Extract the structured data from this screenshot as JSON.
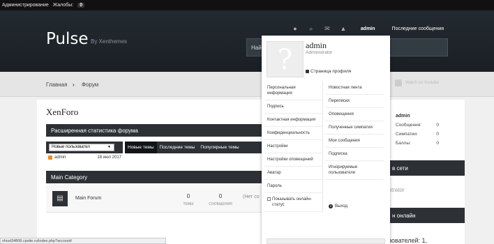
{
  "adminbar": {
    "admin_link": "Администрирование",
    "reports_label": "Жалобы:",
    "reports_count": "0"
  },
  "header": {
    "logo": "Pulse",
    "byline": "By Xenthemes",
    "search_label": "Найти"
  },
  "topnav": {
    "user": "admin",
    "recent": "Последние сообщения"
  },
  "breadcrumb": {
    "home": "Главная",
    "separator": "›",
    "forum": "Форум"
  },
  "youtube": {
    "label": "Watch on Youtube"
  },
  "page": {
    "title": "XenForo"
  },
  "stats": {
    "title": "Расширенная статистика форума",
    "select_value": "Новые пользовател",
    "user": "admin",
    "date": "18 июл 2017",
    "tabs": [
      "Новые темы",
      "Последние темы",
      "Популярные темы"
    ]
  },
  "category": {
    "title": "Main Category",
    "forum": "Main Forum",
    "threads_count": "0",
    "threads_label": "ТЕМЫ",
    "posts_count": "0",
    "posts_label": "СООБЩЕНИЯ",
    "last_post": "(Нет со"
  },
  "sidebar": {
    "user": "admin",
    "rows": [
      {
        "label": "Сообщения:",
        "value": "0"
      },
      {
        "label": "Симпатии:",
        "value": "0"
      },
      {
        "label": "Баллы:",
        "value": "0"
      }
    ],
    "online_title": "в сети",
    "online_user": "strator",
    "online2_title": "н онлайн",
    "visitors": "зователей: 1,"
  },
  "popup": {
    "name": "admin",
    "role": "Administrator",
    "profile_link": "Страница профиля",
    "left": [
      "Персональная информация",
      "Подпись",
      "Контактная информация",
      "Конфиденциальность",
      "Настройки",
      "Настройки оповещений",
      "Аватар",
      "Пароль"
    ],
    "right": [
      "Новостная лента",
      "Переписки",
      "Оповещения",
      "Полученные симпатии",
      "Мои сообщения",
      "Подписка",
      "Игнорируемые пользователи"
    ],
    "show_online": "Показывать онлайн-статус",
    "logout": "Выход"
  },
  "status": {
    "url": "vhost34806.cpsite.ru/index.php?account/"
  }
}
